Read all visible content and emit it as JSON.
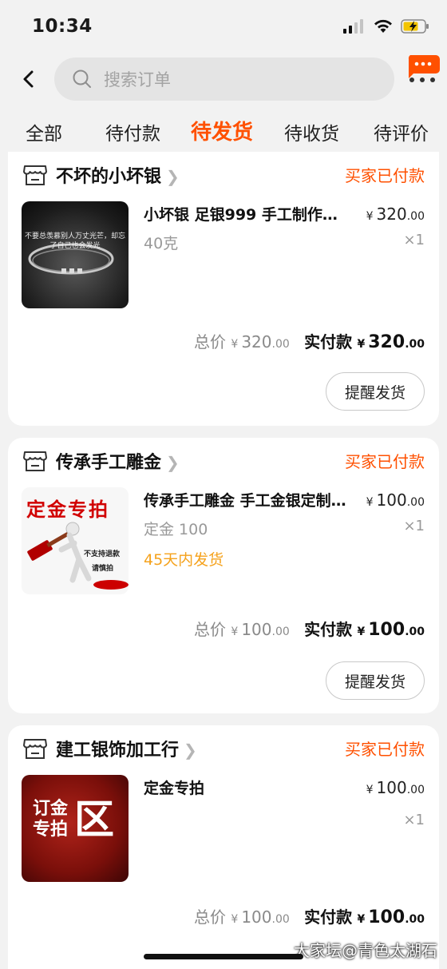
{
  "status_bar": {
    "time": "10:34"
  },
  "search": {
    "placeholder": "搜索订单"
  },
  "tabs": [
    {
      "label": "全部",
      "active": false
    },
    {
      "label": "待付款",
      "active": false
    },
    {
      "label": "待发货",
      "active": true
    },
    {
      "label": "待收货",
      "active": false
    },
    {
      "label": "待评价",
      "active": false
    }
  ],
  "orders": [
    {
      "shop": "不坏的小坏银",
      "status": "买家已付款",
      "thumb_caption": "不要总羡慕别人万丈光芒，却忘了自己也会发光",
      "title": "小坏银 足银999 手工制作…",
      "spec": "40克",
      "ship_note": "",
      "price_int": "320",
      "price_dec": ".00",
      "qty": "×1",
      "total_label": "总价",
      "total_int": "320",
      "total_dec": ".00",
      "paid_label": "实付款",
      "paid_int": "320",
      "paid_dec": ".00",
      "button": "提醒发货"
    },
    {
      "shop": "传承手工雕金",
      "status": "买家已付款",
      "thumb_caption": "定金专拍",
      "thumb_sub1": "不支持退款",
      "thumb_sub2": "请慎拍",
      "title": "传承手工雕金 手工金银定制…",
      "spec": "定金 100",
      "ship_note": "45天内发货",
      "price_int": "100",
      "price_dec": ".00",
      "qty": "×1",
      "total_label": "总价",
      "total_int": "100",
      "total_dec": ".00",
      "paid_label": "实付款",
      "paid_int": "100",
      "paid_dec": ".00",
      "button": "提醒发货"
    },
    {
      "shop": "建工银饰加工行",
      "status": "买家已付款",
      "thumb_line1": "订金",
      "thumb_line2": "专拍",
      "thumb_big": "区",
      "title": "定金专拍",
      "spec": "",
      "ship_note": "",
      "price_int": "100",
      "price_dec": ".00",
      "qty": "×1",
      "total_label": "总价",
      "total_int": "100",
      "total_dec": ".00",
      "paid_label": "实付款",
      "paid_int": "100",
      "paid_dec": ".00"
    }
  ],
  "currency_symbol": "¥",
  "watermark": "大家坛@青色太湖石",
  "colors": {
    "accent": "#ff5000",
    "ship_note": "#f5a21c",
    "background": "#f2f2f2"
  }
}
